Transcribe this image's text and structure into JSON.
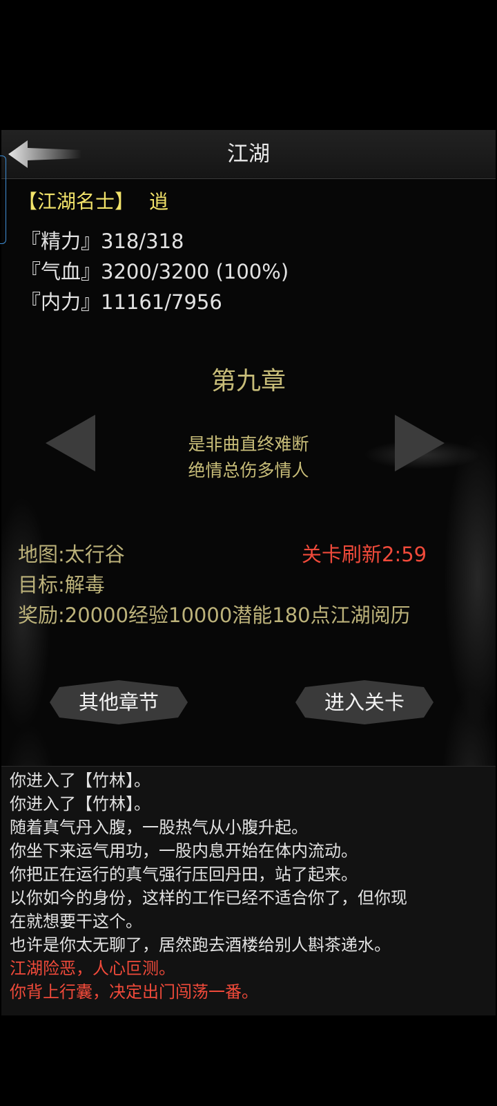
{
  "header": {
    "title": "江湖"
  },
  "player": {
    "rank": "【江湖名士】",
    "name": "逍",
    "stats": [
      "『精力』318/318",
      "『气血』3200/3200 (100%)",
      "『内力』11161/7956"
    ]
  },
  "chapter": {
    "title": "第九章",
    "lines": [
      "是非曲直终难断",
      "绝情总伤多情人"
    ]
  },
  "stage": {
    "map": "地图:太行谷",
    "goal": "目标:解毒",
    "reward": "奖励:20000经验10000潜能180点江湖阅历",
    "refresh": "关卡刷新2:59"
  },
  "buttons": {
    "other_chapters": "其他章节",
    "enter_stage": "进入关卡"
  },
  "log": [
    {
      "text": "你进入了【竹林】。",
      "color": "#e2e2e2"
    },
    {
      "text": "你进入了【竹林】。",
      "color": "#e2e2e2"
    },
    {
      "text": "随着真气丹入腹，一股热气从小腹升起。",
      "color": "#e2e2e2"
    },
    {
      "text": "你坐下来运气用功，一股内息开始在体内流动。",
      "color": "#e2e2e2"
    },
    {
      "text": "你把正在运行的真气强行压回丹田，站了起来。",
      "color": "#e2e2e2"
    },
    {
      "text": "以你如今的身份，这样的工作已经不适合你了，但你现",
      "color": "#e2e2e2"
    },
    {
      "text": "在就想要干这个。",
      "color": "#e2e2e2"
    },
    {
      "text": "也许是你太无聊了，居然跑去酒楼给别人斟茶递水。",
      "color": "#e2e2e2"
    },
    {
      "text": "江湖险恶，人心叵测。",
      "color": "#f04a3a"
    },
    {
      "text": "你背上行囊，决定出门闯荡一番。",
      "color": "#f04a3a"
    }
  ],
  "colors": {
    "gold": "#f2e36a",
    "muted_gold": "#c8bd79",
    "alert_red": "#f04a3a"
  },
  "icons": {
    "back": "back-arrow-icon",
    "prev": "triangle-left-icon",
    "next": "triangle-right-icon"
  }
}
